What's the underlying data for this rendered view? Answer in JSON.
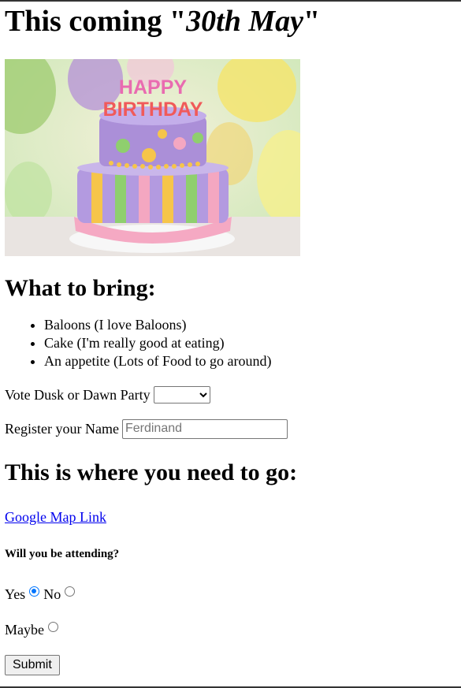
{
  "title": {
    "prefix": "This coming \"",
    "date": "30th May",
    "suffix": "\""
  },
  "hero_image": {
    "cake_text": "HAPPY BIRTHDAY",
    "colors": [
      "#a58fd6",
      "#f7c64a",
      "#7fc36b",
      "#f4a7c1",
      "#ffffff"
    ]
  },
  "bring": {
    "heading": "What to bring:",
    "items": [
      "Baloons (I love Baloons)",
      "Cake (I'm really good at eating)",
      "An appetite (Lots of Food to go around)"
    ]
  },
  "vote": {
    "label": "Vote Dusk or Dawn Party",
    "selected": ""
  },
  "register": {
    "label": "Register your Name",
    "placeholder": "Ferdinand"
  },
  "directions": {
    "heading": "This is where you need to go:",
    "link_text": "Google Map Link"
  },
  "attending": {
    "heading": "Will you be attending?",
    "options": [
      "Yes",
      "No",
      "Maybe"
    ],
    "selected": "Yes"
  },
  "submit_label": "Submit"
}
